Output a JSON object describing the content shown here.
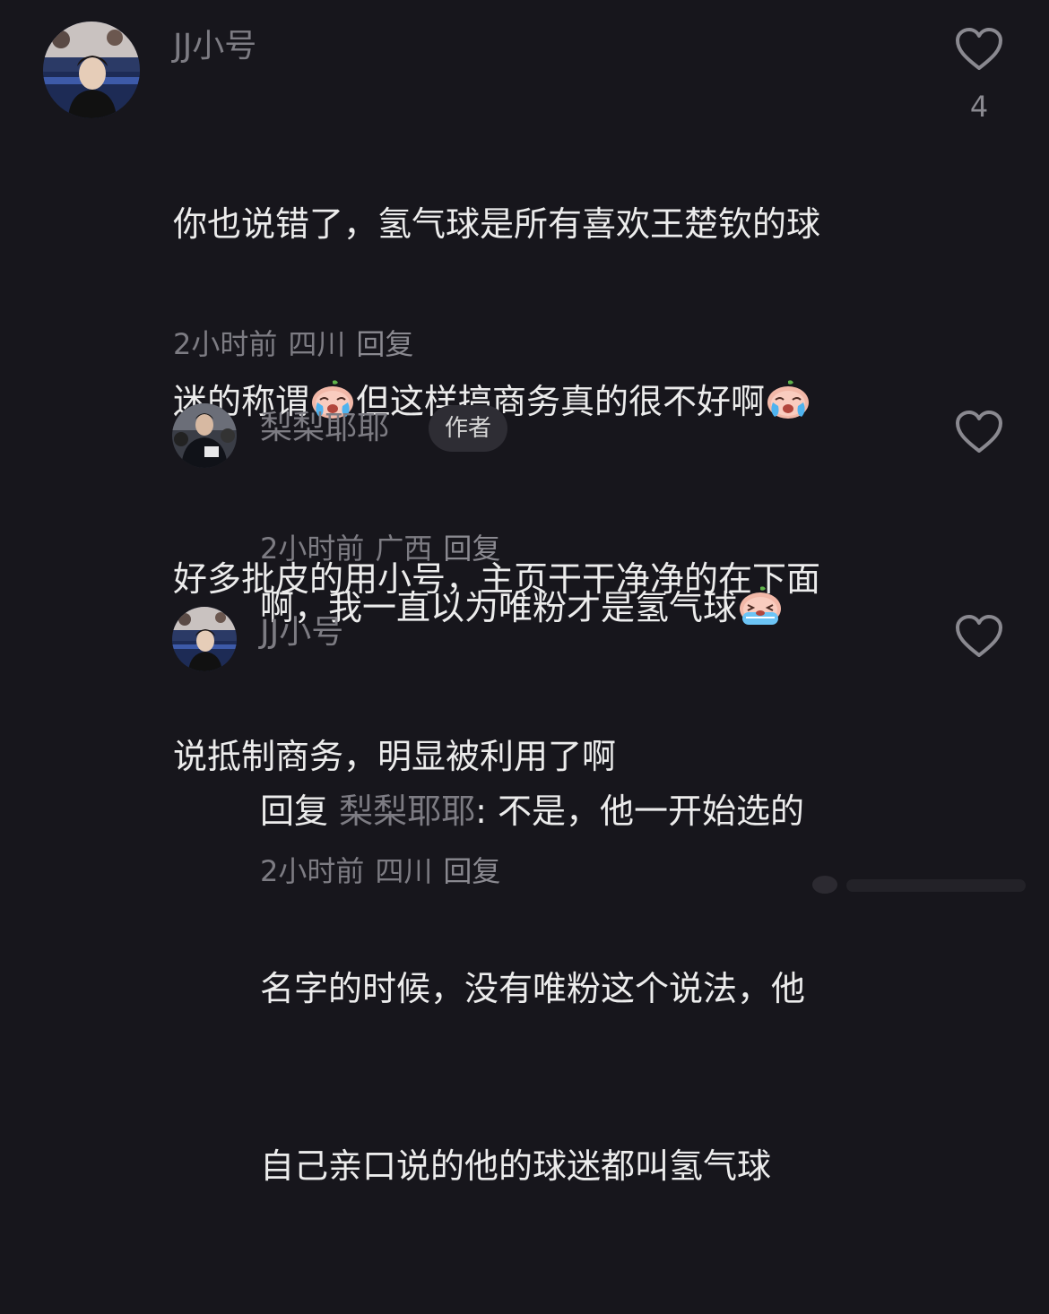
{
  "comments": [
    {
      "username": "JJ小号",
      "text_lines": [
        "你也说错了，氢气球是所有喜欢王楚钦的球",
        "迷的称谓",
        "但这样搞商务真的很不好啊",
        "好多批皮的用小号，主页干干净净的在下面",
        "说抵制商务，明显被利用了啊"
      ],
      "time": "2小时前",
      "location": "四川",
      "reply_label": "回复",
      "like_count": "4",
      "avatar_icon": "avatar-photo-icon",
      "like_icon": "heart-outline-icon",
      "emoji_icon": "crying-face-emoji-icon"
    },
    {
      "username": "梨梨耶耶",
      "badge": "作者",
      "text": "啊，我一直以为唯粉才是氢气球",
      "time": "2小时前",
      "location": "广西",
      "reply_label": "回复",
      "like_count": "",
      "avatar_icon": "avatar-photo-icon",
      "like_icon": "heart-outline-icon",
      "emoji_icon": "crying-face-emoji-icon"
    },
    {
      "username": "JJ小号",
      "reply_prefix": "回复",
      "mention": "梨梨耶耶",
      "text_lines": [
        ": 不是，他一开始选的",
        "名字的时候，没有唯粉这个说法，他",
        "自己亲口说的他的球迷都叫氢气球"
      ],
      "time": "2小时前",
      "location": "四川",
      "reply_label": "回复",
      "like_count": "",
      "avatar_icon": "avatar-photo-icon",
      "like_icon": "heart-outline-icon"
    }
  ],
  "colors": {
    "background": "#17161c",
    "text": "#ececec",
    "muted": "#7d7c83",
    "badge_bg": "#2e2d34"
  }
}
